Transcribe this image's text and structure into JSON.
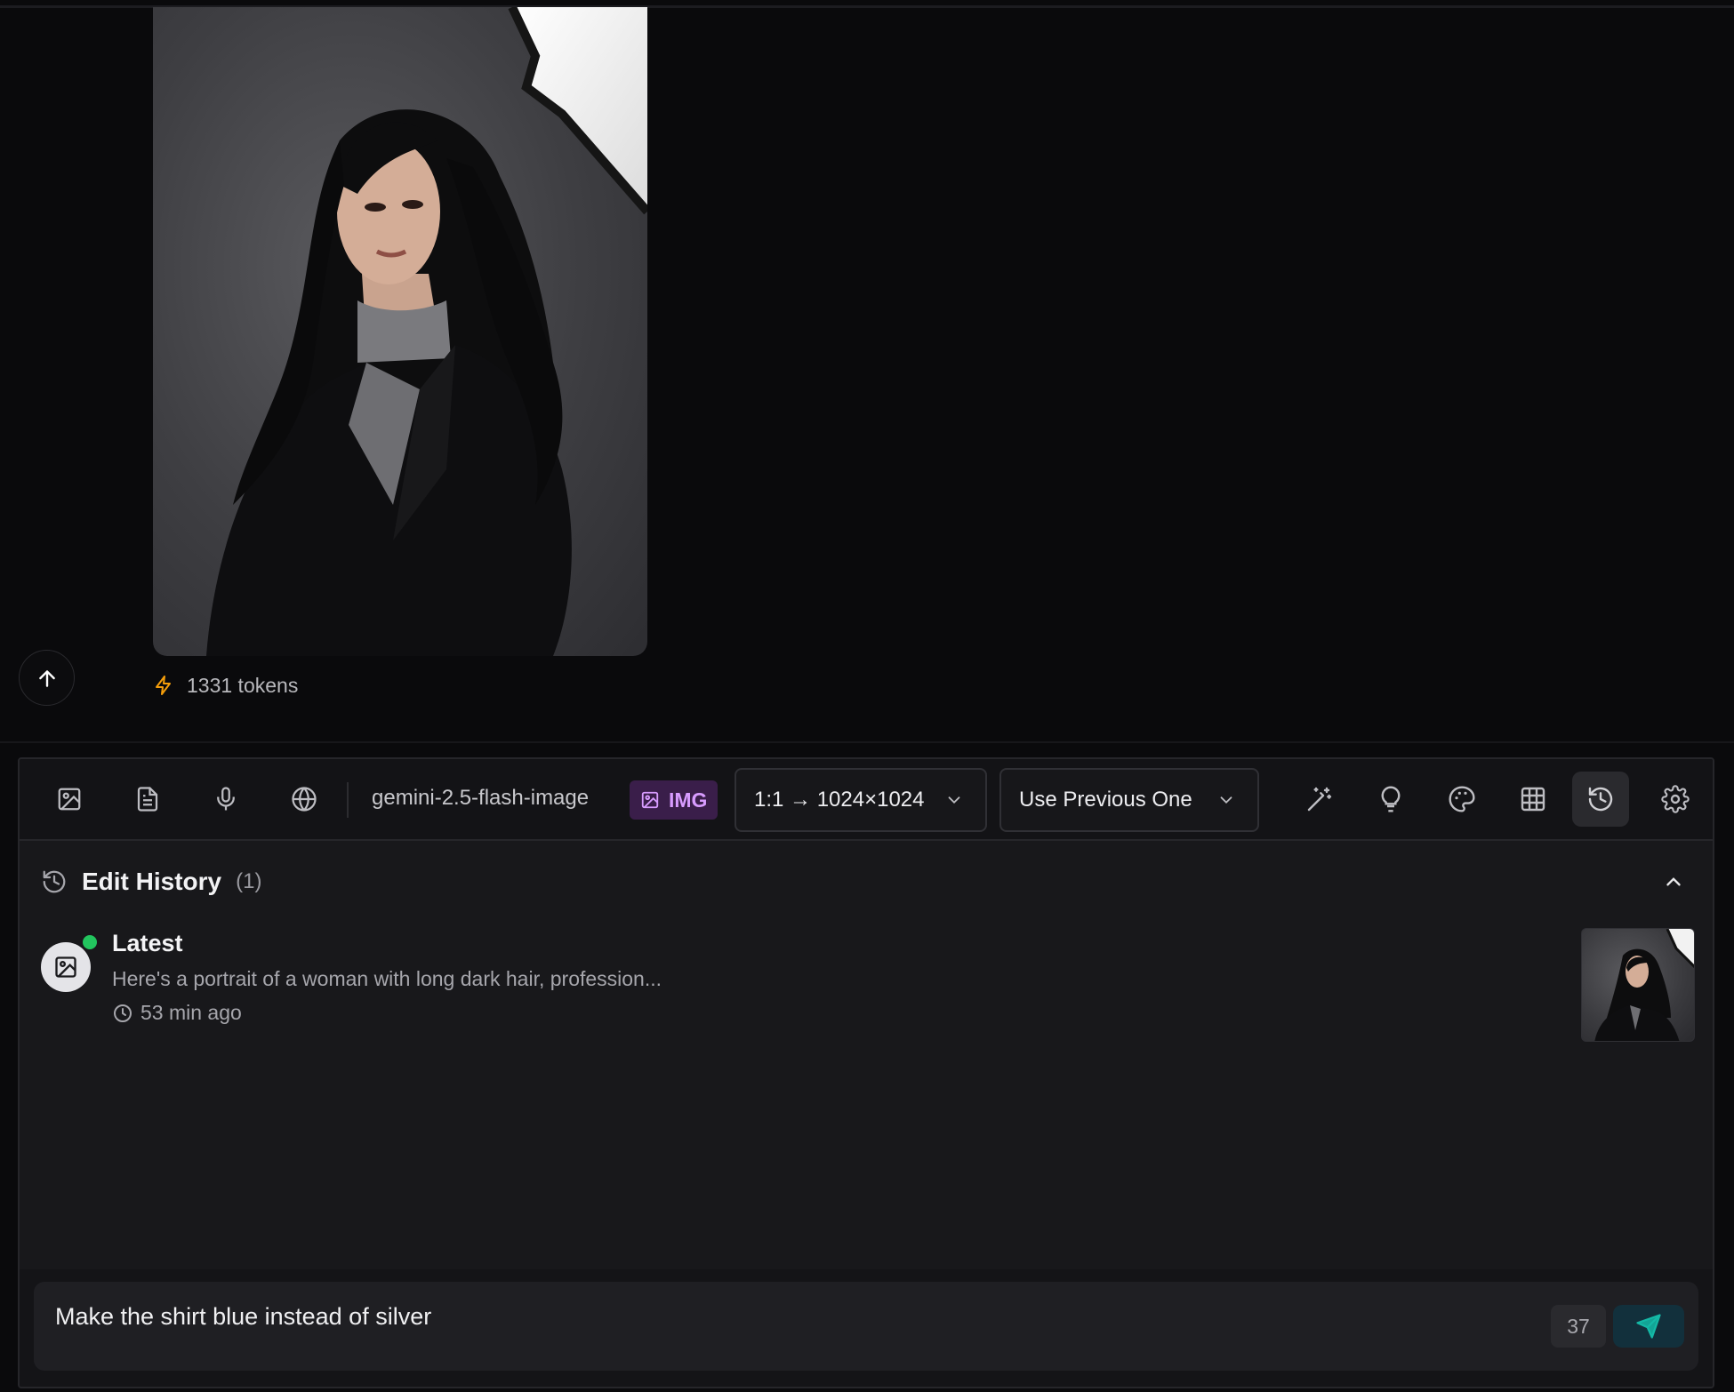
{
  "message": {
    "image_alt": "Portrait of a woman with long dark hair in a black blazer",
    "tokens_label": "1331 tokens"
  },
  "toolbar": {
    "model_name": "gemini-2.5-flash-image",
    "model_badge": "IMG",
    "aspect_select": "1:1 → 1024×1024",
    "reference_select": "Use Previous One"
  },
  "history": {
    "title": "Edit History",
    "count": "(1)",
    "items": [
      {
        "title": "Latest",
        "description": "Here's a portrait of a woman with long dark hair, profession...",
        "time": "53 min ago"
      }
    ]
  },
  "composer": {
    "text": "Make the shirt blue instead of silver",
    "char_count": "37"
  },
  "colors": {
    "accent_badge": "#d89cff",
    "status_dot": "#22c55e",
    "token_bolt": "#f59e0b",
    "send": "#14b8a6"
  }
}
